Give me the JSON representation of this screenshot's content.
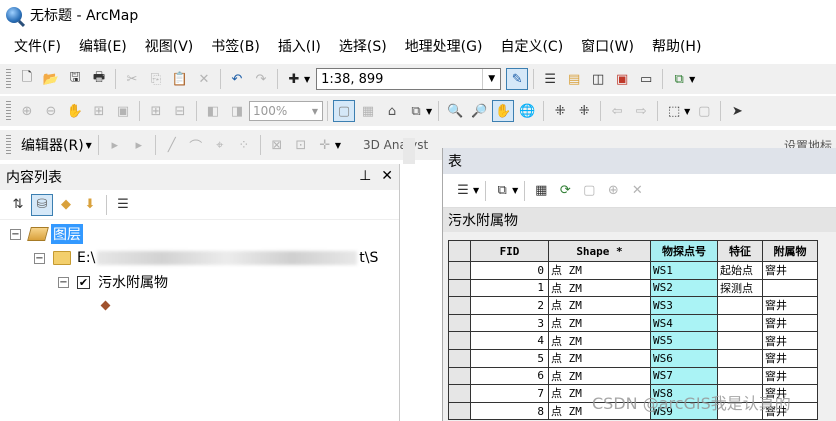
{
  "window": {
    "title": "无标题 - ArcMap",
    "app_icon": "arcmap-globe-icon"
  },
  "menu": [
    "文件(F)",
    "编辑(E)",
    "视图(V)",
    "书签(B)",
    "插入(I)",
    "选择(S)",
    "地理处理(G)",
    "自定义(C)",
    "窗口(W)",
    "帮助(H)"
  ],
  "toolbar1": {
    "scale_value": "1:38, 899"
  },
  "toolbar2": {
    "zoom_value": "100%"
  },
  "toolbar3": {
    "editor_label": "编辑器(R)",
    "trailing_text": "3D Analyst",
    "right_text": "设置地标"
  },
  "toc": {
    "title": "内容列表",
    "pin": "⊥",
    "close": "✕",
    "layers_label": "图层",
    "folder_prefix": "E:\\",
    "folder_suffix": "t\\S",
    "layer_name": "污水附属物",
    "checkbox_checked": true
  },
  "table": {
    "window_title": "表",
    "tab_title": "污水附属物",
    "columns": [
      "FID",
      "Shape *",
      "物探点号",
      "特征",
      "附属物"
    ],
    "selected_column": "物探点号",
    "rows": [
      {
        "fid": "0",
        "shape": "点 ZM",
        "id": "WS1",
        "feature": "起始点",
        "attach": "窨井"
      },
      {
        "fid": "1",
        "shape": "点 ZM",
        "id": "WS2",
        "feature": "探测点",
        "attach": ""
      },
      {
        "fid": "2",
        "shape": "点 ZM",
        "id": "WS3",
        "feature": "",
        "attach": "窨井"
      },
      {
        "fid": "3",
        "shape": "点 ZM",
        "id": "WS4",
        "feature": "",
        "attach": "窨井"
      },
      {
        "fid": "4",
        "shape": "点 ZM",
        "id": "WS5",
        "feature": "",
        "attach": "窨井"
      },
      {
        "fid": "5",
        "shape": "点 ZM",
        "id": "WS6",
        "feature": "",
        "attach": "窨井"
      },
      {
        "fid": "6",
        "shape": "点 ZM",
        "id": "WS7",
        "feature": "",
        "attach": "窨井"
      },
      {
        "fid": "7",
        "shape": "点 ZM",
        "id": "WS8",
        "feature": "",
        "attach": "窨井"
      },
      {
        "fid": "8",
        "shape": "点 ZM",
        "id": "WS9",
        "feature": "",
        "attach": "窨井"
      }
    ],
    "highlight_color": "#aaf3f5"
  },
  "watermark": "CSDN @arcGIS我是认真的"
}
